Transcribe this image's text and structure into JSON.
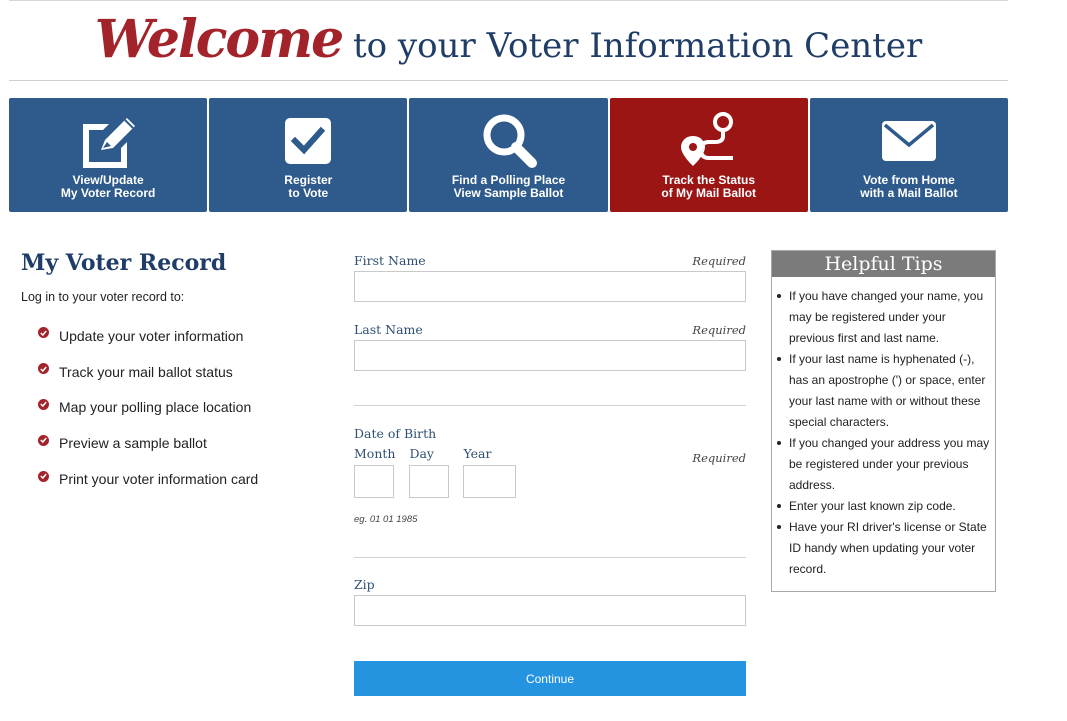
{
  "header": {
    "welcome": "Welcome",
    "title_rest": " to your Voter Information Center"
  },
  "tiles": [
    {
      "line1": "View/Update",
      "line2": "My Voter Record",
      "icon": "edit-icon",
      "active": false
    },
    {
      "line1": "Register",
      "line2": "to Vote",
      "icon": "checkbox-icon",
      "active": false
    },
    {
      "line1": "Find a Polling Place",
      "line2": "View Sample Ballot",
      "icon": "search-icon",
      "active": false
    },
    {
      "line1": "Track the Status",
      "line2": "of My Mail Ballot",
      "icon": "route-pin-icon",
      "active": true
    },
    {
      "line1": "Vote from Home",
      "line2": "with a Mail Ballot",
      "icon": "envelope-icon",
      "active": false
    }
  ],
  "left": {
    "title": "My Voter Record",
    "intro": "Log in to your voter record to:",
    "benefits": [
      "Update your voter information",
      "Track your mail ballot status",
      "Map your polling place location",
      "Preview a sample ballot",
      "Print your voter information card"
    ]
  },
  "form": {
    "first_name_label": "First Name",
    "last_name_label": "Last Name",
    "dob_label": "Date of Birth",
    "month_label": "Month",
    "day_label": "Day",
    "year_label": "Year",
    "dob_hint": "eg. 01 01 1985",
    "zip_label": "Zip",
    "required": "Required",
    "continue": "Continue",
    "first_name_value": "",
    "last_name_value": "",
    "zip_value": ""
  },
  "tips": {
    "title": "Helpful Tips",
    "items": [
      "If you have changed your name, you may be registered under your previous first and last name.",
      "If your last name is hyphenated (-), has an apostrophe (') or space, enter your last name with or without these special characters.",
      "If you changed your address you may be registered under your previous address.",
      "Enter your last known zip code.",
      "Have your RI driver's license or State ID handy when updating your voter record."
    ]
  },
  "colors": {
    "tile_blue": "#2e5b8c",
    "tile_active": "#9b1515",
    "accent_red": "#a3232b",
    "title_navy": "#1f3d66",
    "button_blue": "#2493e0"
  }
}
